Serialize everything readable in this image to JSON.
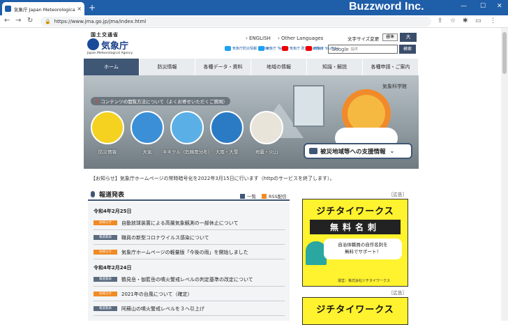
{
  "browser": {
    "tab_title": "気象庁 Japan Meteorological Ag",
    "tab_close": "×",
    "new_tab": "+",
    "brand": "Buzzword Inc.",
    "url": "https://www.jma.go.jp/jma/index.html",
    "lock": "🔒",
    "back": "←",
    "forward": "→",
    "reload": "↻",
    "win_min": "—",
    "win_max": "☐",
    "win_close": "✕",
    "tool_icons": [
      "⇪",
      "☆",
      "✱",
      "▭",
      "⋮"
    ]
  },
  "header": {
    "ministry": "国土交通省",
    "logo_name": "気象庁",
    "logo_sub": "Japan Meteorological Agency",
    "english": "› ENGLISH",
    "other_languages": "› Other Languages",
    "fontsize_label": "文字サイズ変更",
    "fontsize_standard": "標準",
    "fontsize_large": "大",
    "sns": [
      {
        "label": "気象庁防災情報 Twitter",
        "color": "#1da1f2"
      },
      {
        "label": "気象庁 Twitter",
        "color": "#1da1f2"
      },
      {
        "label": "気象庁 防災 YouTube",
        "color": "#e00"
      },
      {
        "label": "気象庁 YouTube",
        "color": "#e00"
      }
    ],
    "search_brand": "Google",
    "search_placeholder": "提供",
    "search_button": "検索"
  },
  "nav": [
    "ホーム",
    "防災情報",
    "各種データ・資料",
    "地域の情報",
    "知識・解説",
    "各種申請・ご案内"
  ],
  "hero": {
    "howto": "❓ コンテンツの閲覧方法について（よくお寄せいただくご質問）",
    "sign": "気象科学館",
    "categories": [
      {
        "label": "防災情報",
        "color": "#f4d21f"
      },
      {
        "label": "天気",
        "color": "#3a8fd6"
      },
      {
        "label": "キキクル（危険度分布）",
        "color": "#5ab0e6"
      },
      {
        "label": "大雨・大雪",
        "color": "#2b7bc4"
      },
      {
        "label": "地震・火山",
        "color": "#e9e4da"
      }
    ],
    "support": "被災地域等への支援情報",
    "support_chevron": "⌄"
  },
  "notice": "【お知らせ】気象庁ホームページの常時暗号化を2022年3月15日に行います（httpのサービスを終了します）。",
  "press": {
    "title": "報道発表",
    "list": "一覧",
    "rss": "RSS配信",
    "groups": [
      {
        "date": "令和4年2月25日",
        "items": [
          {
            "badge": "お知らせ",
            "badge_color": "#f08a24",
            "text": "自動放球装置による高層気象観測の一部休止について"
          },
          {
            "badge": "報道発表",
            "badge_color": "#5a6b80",
            "text": "職員の新型コロナウイルス感染について"
          },
          {
            "badge": "お知らせ",
            "badge_color": "#f08a24",
            "text": "気象庁ホームページの軽量版「今後の雨」を開始しました"
          }
        ]
      },
      {
        "date": "令和4年2月24日",
        "items": [
          {
            "badge": "報道発表",
            "badge_color": "#5a6b80",
            "text": "鶴見岳・伽藍岳の噴火警戒レベルの判定基準の改定について"
          },
          {
            "badge": "お知らせ",
            "badge_color": "#f08a24",
            "text": "2021年の台風について（確定）"
          },
          {
            "badge": "報道発表",
            "badge_color": "#5a6b80",
            "text": "阿蘇山の噴火警戒レベルを３へ引上げ"
          }
        ]
      }
    ]
  },
  "ads": {
    "label": "［広告］",
    "line1": "ジチタイワークス",
    "line2": "無料名刺",
    "bubble_line1": "自治体職員の自作名刺を",
    "bubble_line2": "無料でサポート！",
    "owner": "運営：株式会社ジチタイワークス"
  }
}
